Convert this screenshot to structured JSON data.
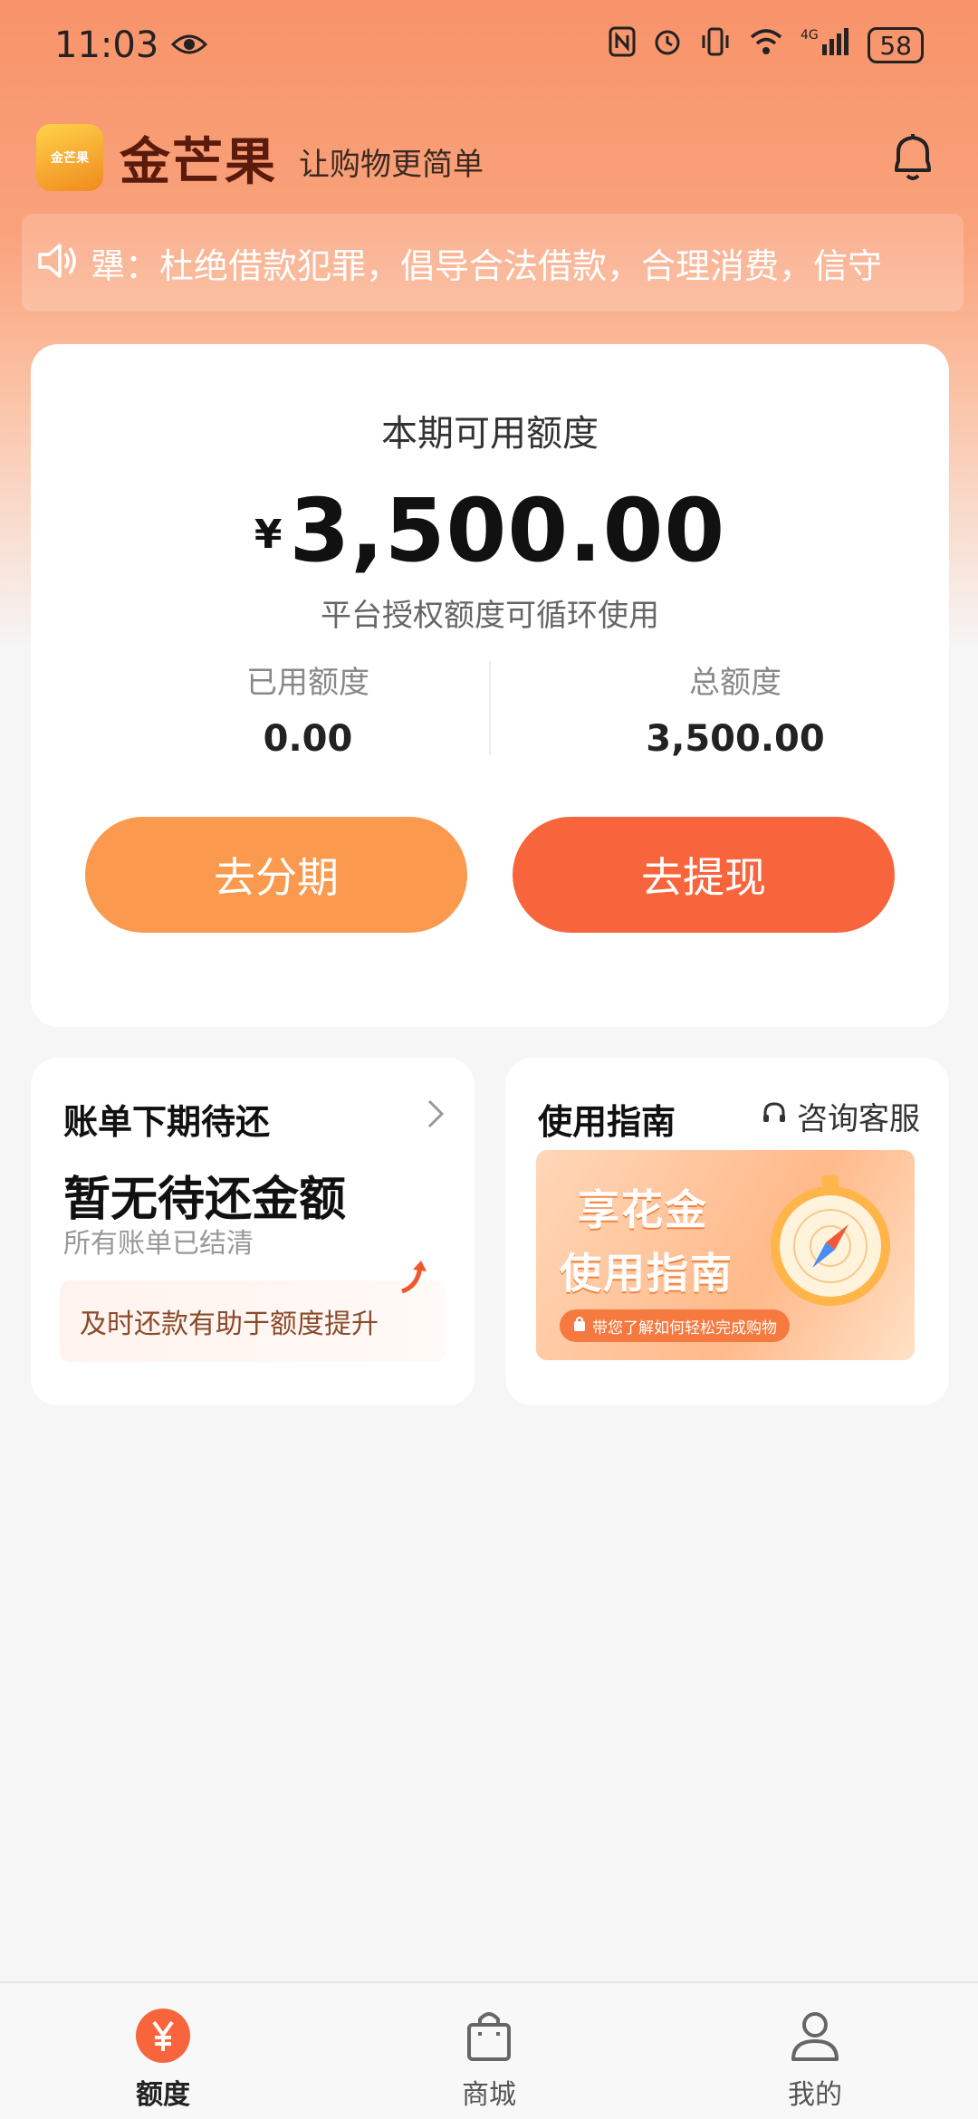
{
  "status_bar": {
    "time": "11:03",
    "battery": "58",
    "network": "4G"
  },
  "header": {
    "brand": "金芒果",
    "slogan": "让购物更简单",
    "logo_text": "金芒果"
  },
  "notice": {
    "text": "犟：杜绝借款犯罪，倡导合法借款，合理消费，信守"
  },
  "credit": {
    "title": "本期可用额度",
    "currency": "¥",
    "available": "3,500.00",
    "subtitle": "平台授权额度可循环使用",
    "used_label": "已用额度",
    "used_value": "0.00",
    "total_label": "总额度",
    "total_value": "3,500.00",
    "installment_button": "去分期",
    "withdraw_button": "去提现"
  },
  "bill": {
    "title": "账单下期待还",
    "main": "暂无待还金额",
    "sub": "所有账单已结清",
    "tip": "及时还款有助于额度提升"
  },
  "guide": {
    "title": "使用指南",
    "service": "咨询客服",
    "banner_line1": "享花金",
    "banner_line2": "使用指南",
    "banner_pill": "带您了解如何轻松完成购物"
  },
  "tabs": [
    {
      "label": "额度",
      "active": true
    },
    {
      "label": "商城",
      "active": false
    },
    {
      "label": "我的",
      "active": false
    }
  ],
  "colors": {
    "accent": "#f8653c",
    "accent_light": "#fb9a4e",
    "brand_text": "#5a1a0c"
  }
}
